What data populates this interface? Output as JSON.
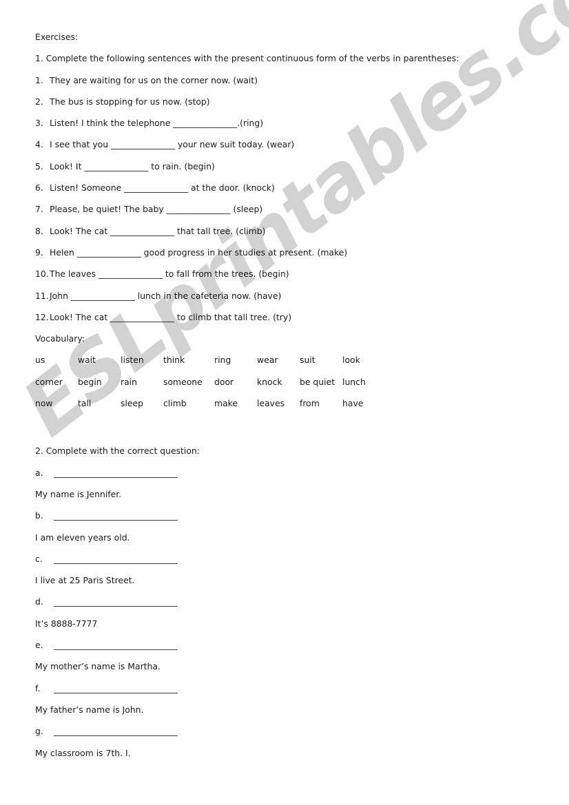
{
  "document": {
    "title": "Exercises:",
    "watermark": "ESLprintables.com"
  },
  "section1": {
    "instruction": "1. Complete the following sentences with the present continuous form of the verbs in parentheses:",
    "items": [
      {
        "num": "1.",
        "text": "They are waiting for us on the corner now. (wait)"
      },
      {
        "num": "2.",
        "text": "The bus is stopping for us now. (stop)"
      },
      {
        "num": "3.",
        "text": "Listen! I think the telephone _______________.(ring)"
      },
      {
        "num": "4.",
        "text": "I see that you _______________ your new suit today. (wear)"
      },
      {
        "num": "5.",
        "text": "Look! It _______________ to rain. (begin)"
      },
      {
        "num": "6.",
        "text": "Listen! Someone _______________ at the door. (knock)"
      },
      {
        "num": "7.",
        "text": "Please, be quiet! The baby _______________ (sleep)"
      },
      {
        "num": "8.",
        "text": "Look! The cat _______________ that tall tree. (climb)"
      },
      {
        "num": "9.",
        "text": "Helen _______________ good progress in her studies at present. (make)"
      },
      {
        "num": "10.",
        "text": "The leaves _______________ to fall from the trees. (begin)"
      },
      {
        "num": "11.",
        "text": "John _______________ lunch in the cafeteria now. (have)"
      },
      {
        "num": "12.",
        "text": "Look! The cat _______________ to climb that tall tree. (try)"
      }
    ]
  },
  "vocabulary": {
    "heading": "Vocabulary:",
    "rows": [
      [
        "us",
        "wait",
        "listen",
        "think",
        "ring",
        "wear",
        "suit",
        "look"
      ],
      [
        "corner",
        "begin",
        "rain",
        "someone",
        "door",
        "knock",
        "be quiet",
        "lunch"
      ],
      [
        "now",
        "tall",
        "sleep",
        "climb",
        "make",
        "leaves",
        "from",
        "have"
      ]
    ]
  },
  "section2": {
    "instruction": "2. Complete with the correct question:",
    "items": [
      {
        "letter": "a.",
        "blank": "_____________________________",
        "answer": "My name is Jennifer."
      },
      {
        "letter": "b.",
        "blank": "_____________________________",
        "answer": "I am eleven years old."
      },
      {
        "letter": "c.",
        "blank": "_____________________________",
        "answer": "I live at 25 Paris Street."
      },
      {
        "letter": "d.",
        "blank": "_____________________________",
        "answer": "It’s 8888-7777"
      },
      {
        "letter": "e.",
        "blank": "_____________________________",
        "answer": "My mother’s name is Martha."
      },
      {
        "letter": "f.",
        "blank": "_____________________________",
        "answer": "My father’s name is John."
      },
      {
        "letter": "g.",
        "blank": "_____________________________",
        "answer": "My classroom is 7th. I."
      }
    ]
  }
}
